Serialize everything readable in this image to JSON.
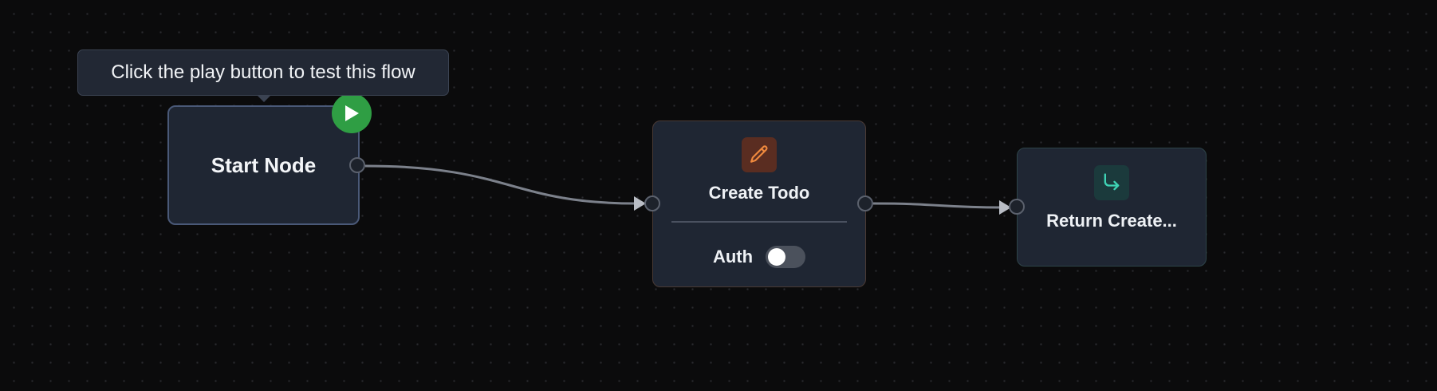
{
  "tooltip": {
    "text": "Click the play button to test this flow"
  },
  "nodes": {
    "start": {
      "title": "Start Node",
      "action_icon": "play-icon",
      "action_color": "#2f9e44"
    },
    "create_todo": {
      "title": "Create Todo",
      "icon": "pencil-icon",
      "icon_color": "#f08a3e",
      "icon_background": "#5a2d21",
      "auth": {
        "label": "Auth",
        "enabled": false
      }
    },
    "return": {
      "title": "Return Create...",
      "icon": "return-arrow-icon",
      "icon_color": "#3fd3b5",
      "icon_background": "#1b3a3c"
    }
  },
  "edges": [
    {
      "from": "Start Node",
      "to": "Create Todo"
    },
    {
      "from": "Create Todo",
      "to": "Return Create..."
    }
  ]
}
